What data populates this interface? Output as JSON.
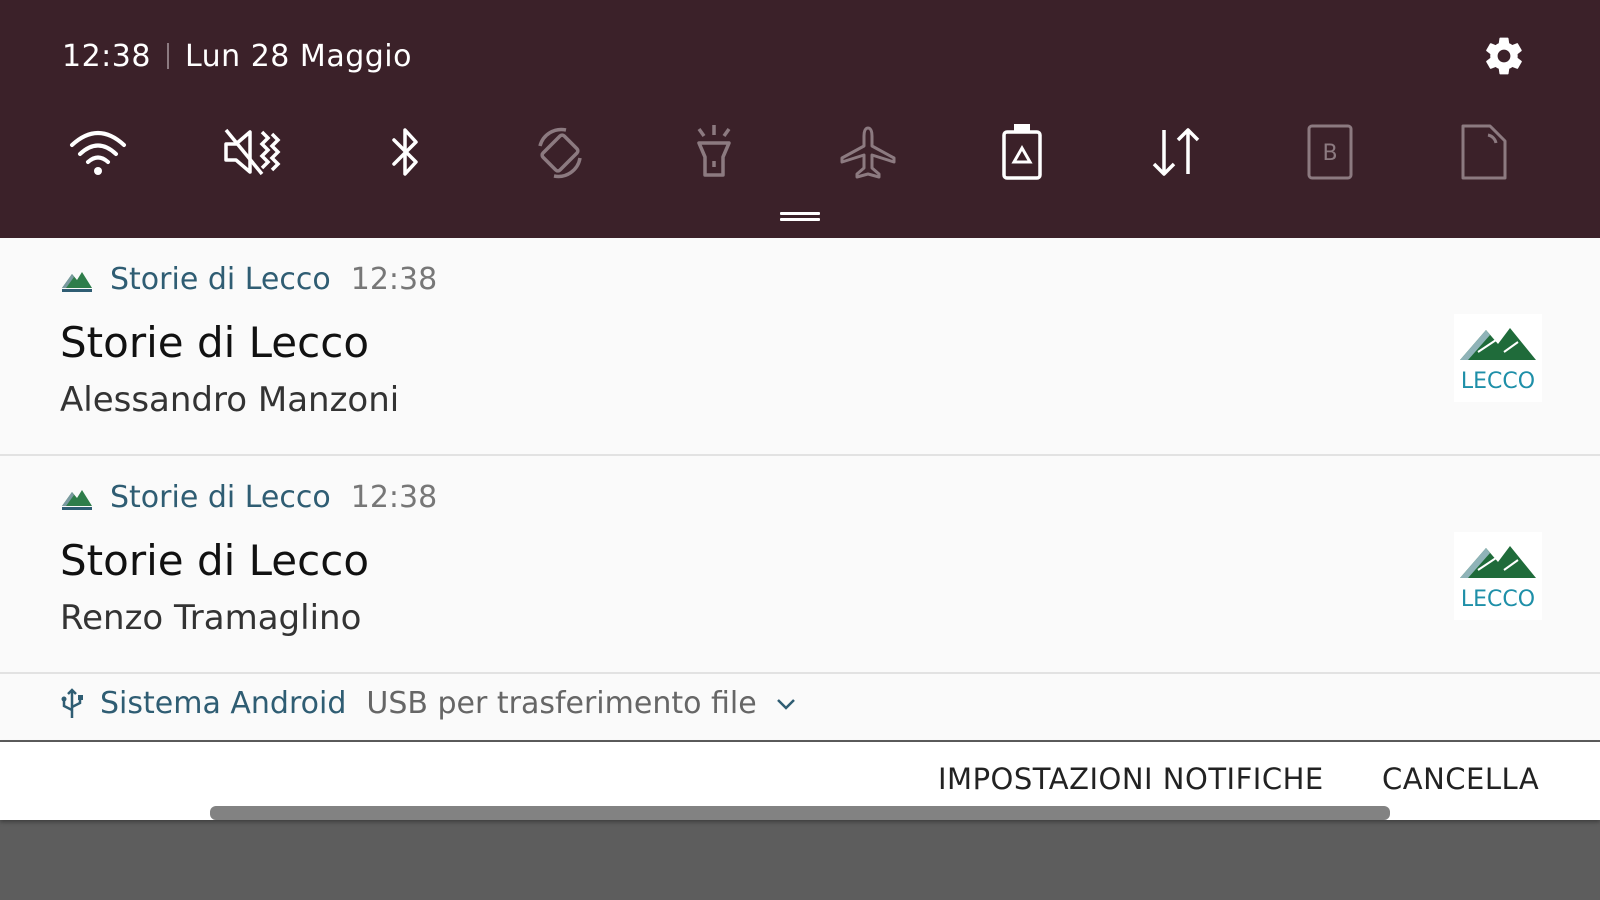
{
  "status": {
    "time": "12:38",
    "date": "Lun 28 Maggio"
  },
  "quick_settings": {
    "tiles": [
      {
        "icon": "wifi-icon",
        "active": true
      },
      {
        "icon": "sound-muted-vibrate-icon",
        "active": true
      },
      {
        "icon": "bluetooth-icon",
        "active": true
      },
      {
        "icon": "auto-rotate-icon",
        "active": false
      },
      {
        "icon": "flashlight-icon",
        "active": false
      },
      {
        "icon": "airplane-mode-icon",
        "active": false
      },
      {
        "icon": "power-saving-icon",
        "active": true
      },
      {
        "icon": "mobile-data-icon",
        "active": true
      },
      {
        "icon": "blue-light-filter-icon",
        "active": false
      },
      {
        "icon": "nfc-icon",
        "active": false
      }
    ],
    "colors": {
      "panel_bg": "#3b2129",
      "active_icon": "#ffffff",
      "inactive_icon": "#8c7a80"
    }
  },
  "notifications": [
    {
      "app_name": "Storie di Lecco",
      "time": "12:38",
      "title": "Storie di Lecco",
      "text": "Alessandro Manzoni",
      "large_icon_label": "LECCO"
    },
    {
      "app_name": "Storie di Lecco",
      "time": "12:38",
      "title": "Storie di Lecco",
      "text": "Renzo Tramaglino",
      "large_icon_label": "LECCO"
    }
  ],
  "system_notification": {
    "app_name": "Sistema Android",
    "text": "USB per trasferimento file"
  },
  "actions": {
    "settings_label": "IMPOSTAZIONI NOTIFICHE",
    "clear_label": "CANCELLA"
  }
}
